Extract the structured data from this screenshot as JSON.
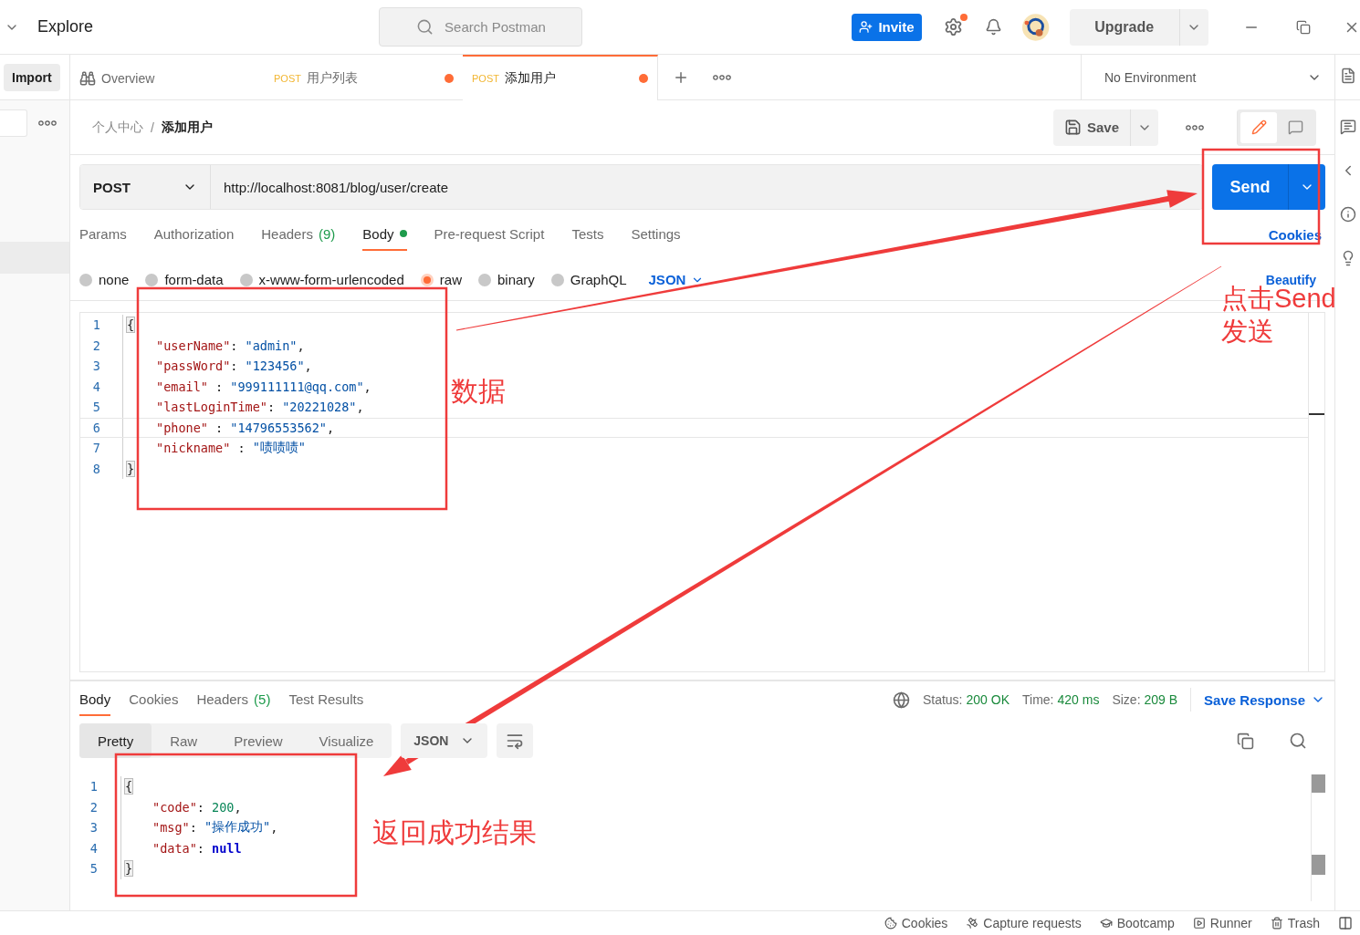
{
  "top_bar": {
    "menu": "Explore",
    "search": {
      "placeholder": "Search Postman"
    },
    "invite": "Invite",
    "upgrade": "Upgrade"
  },
  "sidebar": {
    "import": "Import"
  },
  "tabs": [
    {
      "kind": "overview",
      "label": "Overview",
      "selected": false,
      "unsaved": false
    },
    {
      "kind": "request",
      "method": "POST",
      "label": "用户列表",
      "selected": false,
      "unsaved": true
    },
    {
      "kind": "request",
      "method": "POST",
      "label": "添加用户",
      "selected": true,
      "unsaved": true
    }
  ],
  "environment": "No Environment",
  "breadcrumb": [
    "个人中心",
    "添加用户"
  ],
  "breadcrumb_separator": "/",
  "save": "Save",
  "mode_toggle": [
    {
      "kind": "edit",
      "selected": true
    },
    {
      "kind": "comments",
      "selected": false
    }
  ],
  "request": {
    "method": "POST",
    "url": "http://localhost:8081/blog/user/create",
    "send": "Send"
  },
  "request_tabs": [
    {
      "label": "Params",
      "selected": false
    },
    {
      "label": "Authorization",
      "selected": false
    },
    {
      "label": "Headers",
      "count": "(9)",
      "selected": false
    },
    {
      "label": "Body",
      "selected": true,
      "indicator": true
    },
    {
      "label": "Pre-request Script",
      "selected": false
    },
    {
      "label": "Tests",
      "selected": false
    },
    {
      "label": "Settings",
      "selected": false
    }
  ],
  "cookies_link": "Cookies",
  "body_types": [
    {
      "label": "none",
      "selected": false
    },
    {
      "label": "form-data",
      "selected": false
    },
    {
      "label": "x-www-form-urlencoded",
      "selected": false
    },
    {
      "label": "raw",
      "selected": true
    },
    {
      "label": "binary",
      "selected": false
    },
    {
      "label": "GraphQL",
      "selected": false
    }
  ],
  "body_format": "JSON",
  "beautify": "Beautify",
  "editor_lines": [
    {
      "number": "1",
      "indent": false,
      "parts": [
        {
          "kind": "bracket",
          "text": "{"
        }
      ]
    },
    {
      "number": "2",
      "indent": true,
      "parts": [
        {
          "kind": "key",
          "text": "\"userName\""
        },
        {
          "kind": "punct",
          "text": ": "
        },
        {
          "kind": "string",
          "text": "\"admin\""
        },
        {
          "kind": "punct",
          "text": ","
        }
      ]
    },
    {
      "number": "3",
      "indent": true,
      "parts": [
        {
          "kind": "key",
          "text": "\"passWord\""
        },
        {
          "kind": "punct",
          "text": ": "
        },
        {
          "kind": "string",
          "text": "\"123456\""
        },
        {
          "kind": "punct",
          "text": ","
        }
      ]
    },
    {
      "number": "4",
      "indent": true,
      "parts": [
        {
          "kind": "key",
          "text": "\"email\""
        },
        {
          "kind": "punct",
          "text": " : "
        },
        {
          "kind": "string",
          "text": "\"999111111@qq.com\""
        },
        {
          "kind": "punct",
          "text": ","
        }
      ]
    },
    {
      "number": "5",
      "indent": true,
      "parts": [
        {
          "kind": "key",
          "text": "\"lastLoginTime\""
        },
        {
          "kind": "punct",
          "text": ": "
        },
        {
          "kind": "string",
          "text": "\"20221028\""
        },
        {
          "kind": "punct",
          "text": ","
        }
      ]
    },
    {
      "number": "6",
      "indent": true,
      "parts": [
        {
          "kind": "key",
          "text": "\"phone\""
        },
        {
          "kind": "punct",
          "text": " : "
        },
        {
          "kind": "string",
          "text": "\"14796553562\""
        },
        {
          "kind": "punct",
          "text": ","
        }
      ]
    },
    {
      "number": "7",
      "indent": true,
      "parts": [
        {
          "kind": "key",
          "text": "\"nickname\""
        },
        {
          "kind": "punct",
          "text": " : "
        },
        {
          "kind": "string",
          "text": "\"啧啧啧\""
        }
      ]
    },
    {
      "number": "8",
      "indent": false,
      "parts": [
        {
          "kind": "bracket",
          "text": "}"
        }
      ]
    }
  ],
  "response": {
    "tabs": [
      {
        "label": "Body",
        "selected": true
      },
      {
        "label": "Cookies",
        "selected": false
      },
      {
        "label": "Headers",
        "count": "(5)",
        "selected": false
      },
      {
        "label": "Test Results",
        "selected": false
      }
    ],
    "status": [
      {
        "label": "Status:",
        "value": "200 OK"
      },
      {
        "label": "Time:",
        "value": "420 ms"
      },
      {
        "label": "Size:",
        "value": "209 B"
      }
    ],
    "save_response": "Save Response",
    "view_modes": [
      {
        "label": "Pretty",
        "selected": true
      },
      {
        "label": "Raw",
        "selected": false
      },
      {
        "label": "Preview",
        "selected": false
      },
      {
        "label": "Visualize",
        "selected": false
      }
    ],
    "format": "JSON",
    "lines": [
      {
        "number": "1",
        "indent": false,
        "parts": [
          {
            "kind": "bracket",
            "text": "{"
          }
        ]
      },
      {
        "number": "2",
        "indent": true,
        "parts": [
          {
            "kind": "key",
            "text": "\"code\""
          },
          {
            "kind": "punct",
            "text": ": "
          },
          {
            "kind": "number",
            "text": "200"
          },
          {
            "kind": "punct",
            "text": ","
          }
        ]
      },
      {
        "number": "3",
        "indent": true,
        "parts": [
          {
            "kind": "key",
            "text": "\"msg\""
          },
          {
            "kind": "punct",
            "text": ": "
          },
          {
            "kind": "string",
            "text": "\"操作成功\""
          },
          {
            "kind": "punct",
            "text": ","
          }
        ]
      },
      {
        "number": "4",
        "indent": true,
        "parts": [
          {
            "kind": "key",
            "text": "\"data\""
          },
          {
            "kind": "punct",
            "text": ": "
          },
          {
            "kind": "null",
            "text": "null"
          }
        ]
      },
      {
        "number": "5",
        "indent": false,
        "parts": [
          {
            "kind": "bracket",
            "text": "}"
          }
        ]
      }
    ]
  },
  "status_bar": [
    "Cookies",
    "Capture requests",
    "Bootcamp",
    "Runner",
    "Trash"
  ],
  "annotations": {
    "data_note": "数据",
    "send_note": [
      "点击Send",
      "发送"
    ],
    "result_note": "返回成功结果"
  }
}
